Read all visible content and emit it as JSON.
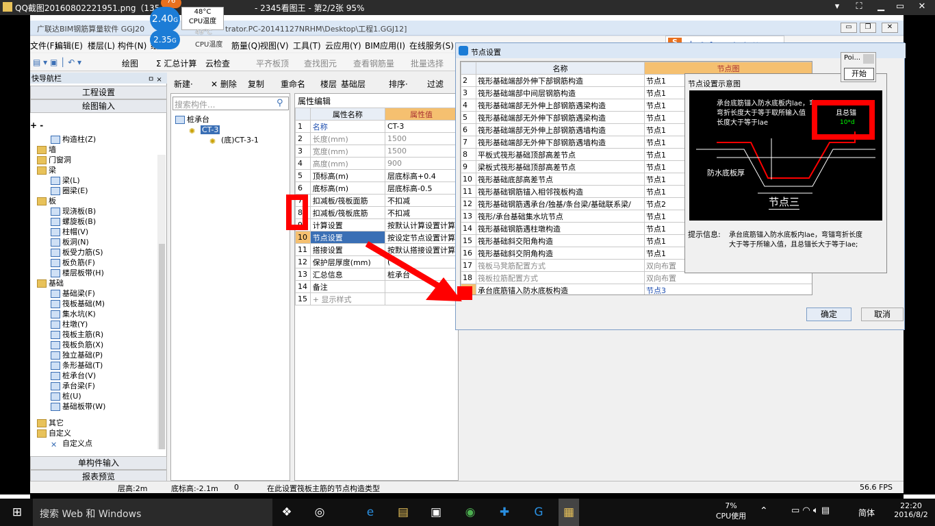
{
  "viewer": {
    "title": "QQ截图20160802221951.png（135",
    "title_tail": "- 2345看图王 - 第2/2张 95%",
    "controls": [
      "▾",
      "⛶",
      "▭",
      "▁",
      "✕"
    ]
  },
  "temp": {
    "t1": "76",
    "v1": "2.40",
    "u1": "G",
    "c1": "48°C",
    "l1": "CPU温度",
    "v2": "2.35",
    "u2": "G",
    "c2": "49°C",
    "l2": "CPU温度"
  },
  "app": {
    "title": "广联达BIM钢筋算量软件 GGJ20",
    "title_tail": "trator.PC-20141127NRHM\\Desktop\\工程1.GGJ12]"
  },
  "menu": [
    "文件(F)",
    "编辑(E)",
    "楼层(L)",
    "构件(N)",
    "绘",
    "筋量(Q)",
    "视图(V)",
    "工具(T)",
    "云应用(Y)",
    "BIM应用(I)",
    "在线服务(S)"
  ],
  "toolbar": [
    "绘图",
    "Σ 汇总计算",
    "云检查",
    "平齐板顶",
    "查找图元",
    "查看钢筋量",
    "批量选择"
  ],
  "nav": {
    "header": "快导航栏",
    "pin": "ㅁ ×",
    "sec1": "工程设置",
    "sec2": "绘图输入",
    "sec3": "单构件输入",
    "sec4": "报表预览",
    "items": [
      "构造柱(Z)",
      "墙",
      "门窗洞",
      "梁",
      "梁(L)",
      "圈梁(E)",
      "板",
      "现浇板(B)",
      "螺旋板(B)",
      "柱帽(V)",
      "板洞(N)",
      "板受力筋(S)",
      "板负筋(F)",
      "楼层板带(H)",
      "基础",
      "基础梁(F)",
      "筏板基础(M)",
      "集水坑(K)",
      "柱墩(Y)",
      "筏板主筋(R)",
      "筏板负筋(X)",
      "独立基础(P)",
      "条形基础(T)",
      "桩承台(V)",
      "承台梁(F)",
      "桩(U)",
      "基础板带(W)",
      "其它",
      "自定义",
      "自定义点"
    ]
  },
  "mid": {
    "tools": [
      "新建·",
      "✕ 删除",
      "复制",
      "重命名",
      "楼层",
      "基础层",
      "排序·",
      "过滤"
    ],
    "search": "搜索构件...",
    "tree": [
      "桩承台",
      "CT-3",
      "(底)CT-3-1"
    ]
  },
  "prop": {
    "tab": "属性编辑",
    "h1": "属性名称",
    "h2": "属性值",
    "rows": [
      [
        "1",
        "名称",
        "CT-3"
      ],
      [
        "2",
        "长度(mm)",
        "1500"
      ],
      [
        "3",
        "宽度(mm)",
        "1500"
      ],
      [
        "4",
        "高度(mm)",
        "900"
      ],
      [
        "5",
        "顶标高(m)",
        "层底标高+0.4"
      ],
      [
        "6",
        "底标高(m)",
        "层底标高-0.5"
      ],
      [
        "7",
        "扣减板/筏板面筋",
        "不扣减"
      ],
      [
        "8",
        "扣减板/筏板底筋",
        "不扣减"
      ],
      [
        "9",
        "计算设置",
        "按默认计算设置计算"
      ],
      [
        "10",
        "节点设置",
        "按设定节点设置计算"
      ],
      [
        "11",
        "搭接设置",
        "按默认搭接设置计算"
      ],
      [
        "12",
        "保护层厚度(mm)",
        "("
      ],
      [
        "13",
        "汇总信息",
        "桩承台"
      ],
      [
        "14",
        "备注",
        ""
      ],
      [
        "15",
        "+ 显示样式",
        ""
      ]
    ]
  },
  "dlg": {
    "title": "节点设置",
    "h1": "名称",
    "h2": "节点图",
    "rows": [
      [
        "2",
        "筏形基础端部外伸下部钢筋构造",
        "节点1"
      ],
      [
        "3",
        "筏形基础端部中间层钢筋构造",
        "节点1"
      ],
      [
        "4",
        "筏形基础端部无外伸上部钢筋遇梁构造",
        "节点1"
      ],
      [
        "5",
        "筏形基础端部无外伸下部钢筋遇梁构造",
        "节点1"
      ],
      [
        "6",
        "筏形基础端部无外伸上部钢筋遇墙构造",
        "节点1"
      ],
      [
        "7",
        "筏形基础端部无外伸下部钢筋遇墙构造",
        "节点1"
      ],
      [
        "8",
        "平板式筏形基础顶部高差节点",
        "节点1"
      ],
      [
        "9",
        "梁板式筏形基础顶部高差节点",
        "节点1"
      ],
      [
        "10",
        "筏形基础底部高差节点",
        "节点1"
      ],
      [
        "11",
        "筏形基础钢筋锚入相邻筏板构造",
        "节点1"
      ],
      [
        "12",
        "筏形基础钢筋遇承台/独基/条台梁/基础联系梁/",
        "节点2"
      ],
      [
        "13",
        "筏形/承台基础集水坑节点",
        "节点1"
      ],
      [
        "14",
        "筏形基础钢筋遇柱墩构造",
        "节点1"
      ],
      [
        "15",
        "筏形基础斜交阳角构造",
        "节点1"
      ],
      [
        "16",
        "筏形基础斜交阴角构造",
        "节点1"
      ],
      [
        "17",
        "筏板马凳筋配置方式",
        "双向布置"
      ],
      [
        "18",
        "筏板拉筋配置方式",
        "双向布置"
      ],
      [
        "19",
        "承台底筋锚入防水底板构造",
        "节点3"
      ]
    ],
    "diag_title": "节点设置示意图",
    "diag_text1": "承台底筋锚入防水底板内laе，弯",
    "diag_text2": "弯折长度大于等于取所输入值",
    "diag_text2b": "且总锚",
    "diag_text3": "长度大于等于laе",
    "diag_label": "防水底板厚",
    "diag_node": "节点三",
    "diag_dim": "10*d",
    "tip_label": "提示信息:",
    "tip1": "承台底筋锚入防水底板内laе，弯锚弯折长度",
    "tip2": "大于等于所输入值，且总锚长大于等于laе;",
    "ok": "确定",
    "cancel": "取消"
  },
  "popup": {
    "title": "Poi...",
    "button": "开始"
  },
  "status": {
    "s1": "层高:2m",
    "s2": "底标高:-2.1m",
    "s3": "0",
    "s4": "在此设置筏板主筋的节点构造类型",
    "s5": "56.6 FPS"
  },
  "taskbar": {
    "search": "搜索 Web 和 Windows",
    "cpu": "7%",
    "cpu_label": "CPU使用",
    "lang": "简体",
    "time": "22:20",
    "date": "2016/8/2"
  }
}
